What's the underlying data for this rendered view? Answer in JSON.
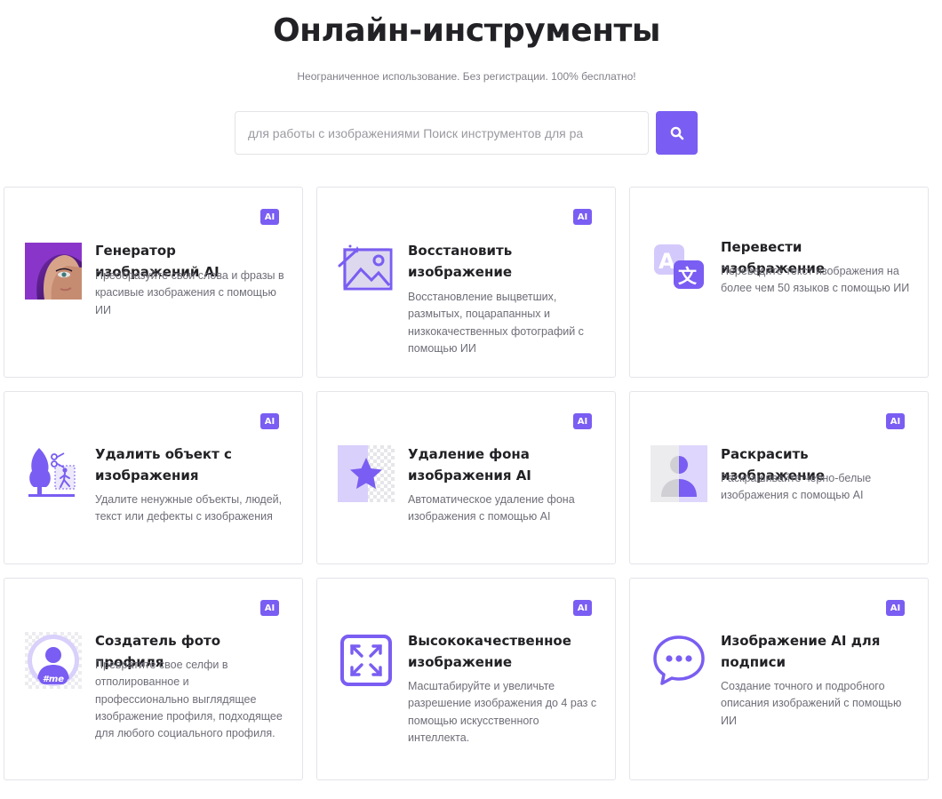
{
  "page": {
    "title": "Онлайн-инструменты",
    "subtitle": "Неограниченное использование. Без регистрации. 100% бесплатно!"
  },
  "search": {
    "placeholder": "для работы с изображениями Поиск инструментов для ра",
    "value": "",
    "button_icon": "search-icon"
  },
  "colors": {
    "accent": "#7a5df2",
    "accent_light": "#d9d0fb",
    "card_border": "#e4e4ea",
    "title_text": "#222226",
    "desc_text": "#6e6e78"
  },
  "tools": [
    {
      "badge": "AI",
      "icon": "ai-portrait-image",
      "title": "Генератор изображений AI",
      "desc": "Преобразуйте свои слова и фразы в красивые изображения с помощью ИИ"
    },
    {
      "badge": "AI",
      "icon": "magic-wand-image-icon",
      "title": "Восстановить изображение",
      "desc": "Восстановление выцветших, размытых, поцарапанных и низкокачественных фотографий с помощью ИИ"
    },
    {
      "badge": "",
      "icon": "translate-icon",
      "title": "Перевести изображение",
      "desc": "Переведите текст изображения на более чем 50 языков с помощью ИИ"
    },
    {
      "badge": "AI",
      "icon": "remove-object-icon",
      "title": "Удалить объект с изображения",
      "desc": "Удалите ненужные объекты, людей, текст или дефекты с изображения"
    },
    {
      "badge": "AI",
      "icon": "background-remove-icon",
      "title": "Удаление фона изображения AI",
      "desc": "Автоматическое удаление фона изображения с помощью AI"
    },
    {
      "badge": "AI",
      "icon": "colorize-icon",
      "title": "Раскрасить изображение",
      "desc": "Раскрашивайте черно-белые изображения с помощью AI"
    },
    {
      "badge": "AI",
      "icon": "profile-photo-icon",
      "title": "Создатель фото профиля",
      "desc": "Превратите свое селфи в отполированное и профессионально выглядящее изображение профиля, подходящее для любого социального профиля."
    },
    {
      "badge": "AI",
      "icon": "upscale-icon",
      "title": "Высококачественное изображение",
      "desc": "Масштабируйте и увеличьте разрешение изображения до 4 раз с помощью искусственного интеллекта."
    },
    {
      "badge": "AI",
      "icon": "chat-bubble-icon",
      "title": "Изображение AI для подписи",
      "desc": "Создание точного и подробного описания изображений с помощью ИИ"
    }
  ]
}
